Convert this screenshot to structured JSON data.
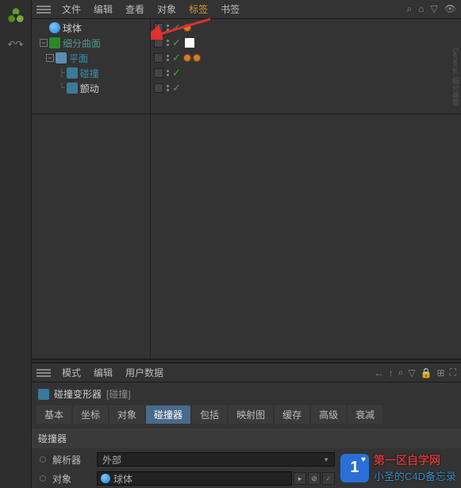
{
  "menu": {
    "file": "文件",
    "edit": "编辑",
    "view": "查看",
    "objects": "对象",
    "tags": "标签",
    "bookmarks": "书签"
  },
  "tree": {
    "sphere": "球体",
    "sds": "细分曲面",
    "plane": "平面",
    "collision": "碰撞",
    "jiggle": "颤动"
  },
  "attr_menu": {
    "mode": "模式",
    "edit": "编辑",
    "userdata": "用户数据"
  },
  "attr_title": {
    "name": "碰撞变形器",
    "bracket": "[碰撞]"
  },
  "tabs": {
    "basic": "基本",
    "coord": "坐标",
    "object": "对象",
    "collider": "碰撞器",
    "include": "包括",
    "maps": "映射图",
    "cache": "缓存",
    "advanced": "高级",
    "falloff": "衰减"
  },
  "section": "碰撞器",
  "props": {
    "resolver_label": "解析器",
    "resolver_value": "外部",
    "object_label": "对象",
    "object_value": "球体"
  },
  "watermark": {
    "main": "第一区自学网",
    "sub": "小圣的C4D备忘录"
  }
}
